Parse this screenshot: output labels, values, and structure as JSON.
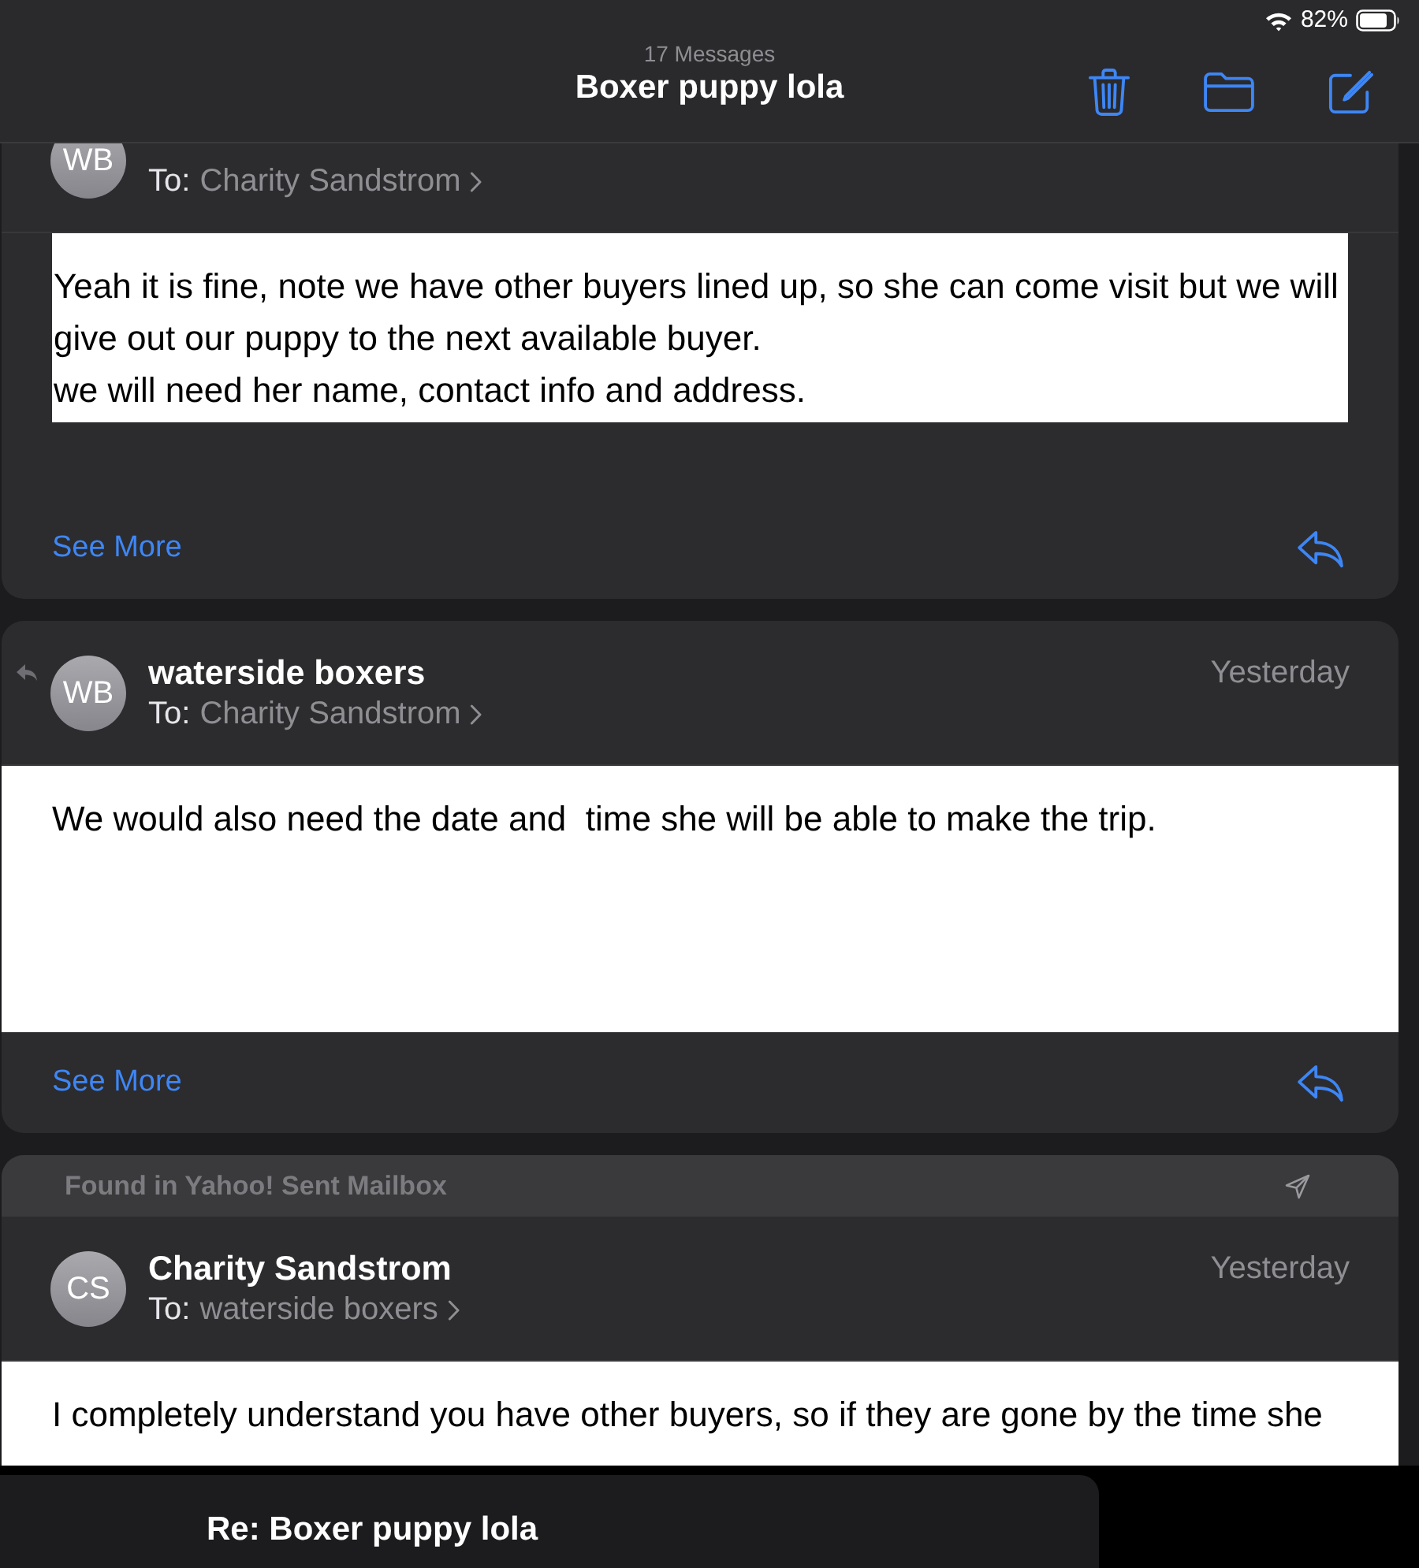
{
  "status_bar": {
    "battery_text": "82%"
  },
  "header": {
    "subtitle": "17 Messages",
    "title": "Boxer puppy lola"
  },
  "messages": [
    {
      "replied": false,
      "avatar_initials": "WB",
      "to_label": "To:",
      "recipient": "Charity Sandstrom",
      "kind": "inset",
      "body": [
        "Yeah it is fine, note we have other buyers lined up, so she can come visit but we will give out our puppy to the next available buyer.",
        "we will need her name, contact info and address."
      ],
      "see_more": "See More"
    },
    {
      "replied": true,
      "avatar_initials": "WB",
      "sender": "waterside boxers",
      "date": "Yesterday",
      "to_label": "To:",
      "recipient": "Charity Sandstrom",
      "kind": "full",
      "body": [
        "We would also need the date and  time she will be able to make the trip."
      ],
      "see_more": "See More"
    },
    {
      "replied": false,
      "banner": "Found in Yahoo! Sent Mailbox",
      "avatar_initials": "CS",
      "sender": "Charity Sandstrom",
      "date": "Yesterday",
      "to_label": "To:",
      "recipient": "waterside boxers",
      "kind": "full",
      "body": [
        "I completely understand you have other buyers, so if they are gone by the time she"
      ]
    }
  ],
  "compose_bar": {
    "title": "Re: Boxer puppy lola"
  }
}
